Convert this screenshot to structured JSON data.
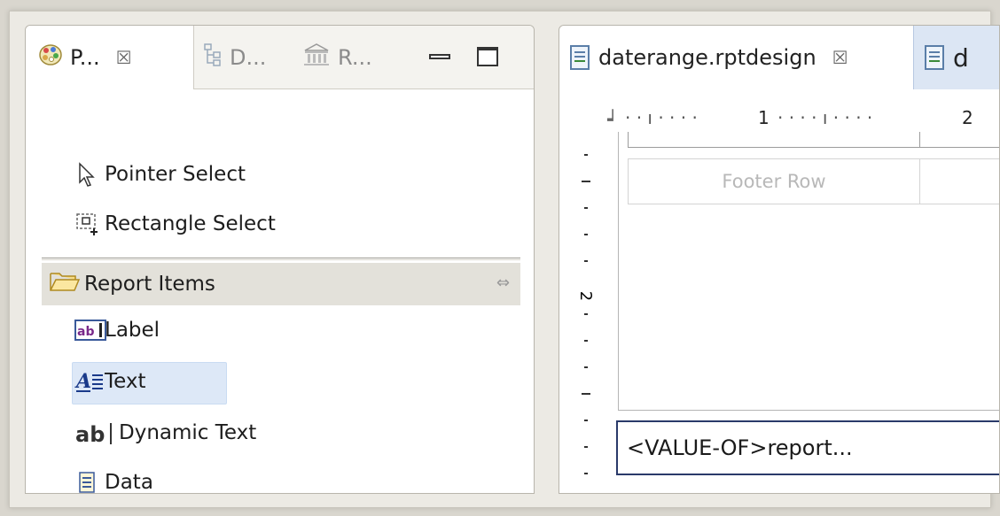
{
  "left_view": {
    "tabs": [
      {
        "label": "P...",
        "icon": "palette-icon",
        "active": true
      },
      {
        "label": "D...",
        "icon": "data-explorer-icon",
        "active": false
      },
      {
        "label": "R...",
        "icon": "resource-explorer-icon",
        "active": false
      }
    ],
    "close_glyph": "☒",
    "tools": [
      {
        "label": "Pointer Select",
        "icon": "pointer-icon"
      },
      {
        "label": "Rectangle Select",
        "icon": "rectangle-select-icon"
      }
    ],
    "drawer": {
      "label": "Report Items",
      "icon": "folder-open-icon"
    },
    "items": [
      {
        "label": "Label",
        "icon": "label-icon"
      },
      {
        "label": "Text",
        "icon": "text-icon",
        "selected": true
      },
      {
        "label": "Dynamic Text",
        "icon": "dynamic-text-icon"
      },
      {
        "label": "Data",
        "icon": "data-icon"
      }
    ]
  },
  "editor": {
    "tabs": [
      {
        "label": "daterange.rptdesign",
        "active": true
      },
      {
        "label": "d",
        "active": false
      }
    ],
    "ruler": {
      "marks": [
        "1",
        "2"
      ],
      "vertical_marks": [
        "2"
      ]
    },
    "footer_row_label": "Footer Row",
    "value_field": "<VALUE-OF>report..."
  },
  "colors": {
    "selected_bg": "#dde8f7",
    "drawer_bg": "#e3e1da",
    "editor_tab_accent": "#dce6f4"
  }
}
